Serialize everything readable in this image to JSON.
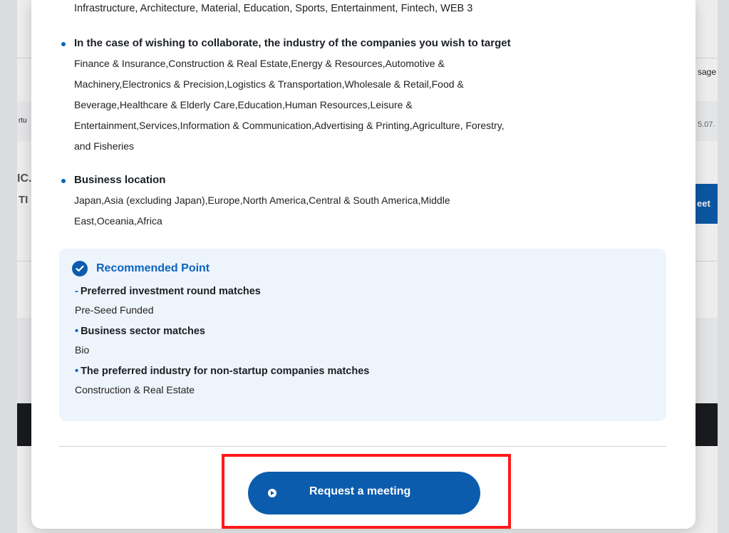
{
  "background": {
    "left_fragments": [
      "rtu",
      "IC.",
      "TI"
    ],
    "right_fragments": [
      "sage",
      "5.07.",
      "eet"
    ]
  },
  "modal": {
    "top_line": "Infrastructure, Architecture, Material, Education, Sports, Entertainment, Fintech, WEB 3",
    "collab_section": {
      "heading": "In the case of wishing to collaborate, the industry of the companies you wish to target",
      "lines": [
        "Finance & Insurance,Construction & Real Estate,Energy & Resources,Automotive &",
        "Machinery,Electronics & Precision,Logistics & Transportation,Wholesale & Retail,Food &",
        "Beverage,Healthcare & Elderly Care,Education,Human Resources,Leisure &",
        "Entertainment,Services,Information & Communication,Advertising & Printing,Agriculture, Forestry,",
        "and Fisheries"
      ]
    },
    "location_section": {
      "heading": "Business location",
      "lines": [
        "Japan,Asia (excluding Japan),Europe,North America,Central & South America,Middle",
        "East,Oceania,Africa"
      ]
    },
    "recommended": {
      "title": "Recommended Point",
      "items": [
        {
          "label": "Preferred investment round matches",
          "value": "Pre-Seed Funded"
        },
        {
          "label": "Business sector matches",
          "value": "Bio"
        },
        {
          "label": "The preferred industry for non-startup companies matches",
          "value": "Construction & Real Estate"
        }
      ]
    },
    "cta": {
      "label": "Request a meeting"
    }
  },
  "colors": {
    "accent": "#0b5cad",
    "link_blue": "#0b64c0",
    "highlight_red": "#ff1a1a",
    "rec_bg": "#eef4fb"
  },
  "icons": {
    "recommended": "check-circle-icon",
    "cta": "arrow-circle-right-icon",
    "bullet": "bullet-dot-icon"
  }
}
